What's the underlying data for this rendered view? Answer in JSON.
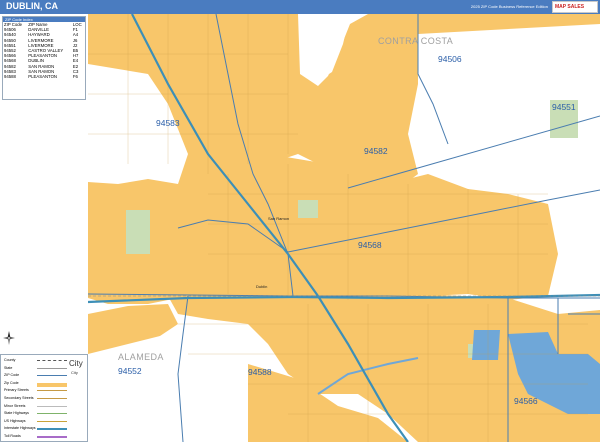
{
  "header": {
    "title": "DUBLIN, CA",
    "subtitle": "2025 ZIP Code Business Reference Edition",
    "logo_text": "MAP SALES"
  },
  "zip_table": {
    "panel_title": "ZIP Code Index",
    "columns": [
      "ZIP Code",
      "ZIP Name",
      "LOC"
    ],
    "rows": [
      [
        "94506",
        "DANVILLE",
        "F1"
      ],
      [
        "94540",
        "HAYWARD",
        "A4"
      ],
      [
        "94550",
        "LIVERMORE",
        "J6"
      ],
      [
        "94551",
        "LIVERMORE",
        "J2"
      ],
      [
        "94552",
        "CASTRO VALLEY",
        "B5"
      ],
      [
        "94566",
        "PLEASANTON",
        "H7"
      ],
      [
        "94568",
        "DUBLIN",
        "E4"
      ],
      [
        "94582",
        "SAN RAMON",
        "E2"
      ],
      [
        "94583",
        "SAN RAMON",
        "C3"
      ],
      [
        "94588",
        "PLEASANTON",
        "F6"
      ]
    ]
  },
  "legend": {
    "items": [
      "County",
      "State",
      "ZIP Code",
      "Zip Code",
      "Primary Streets",
      "Secondary Streets",
      "Minor Streets",
      "State Highways",
      "US Highways",
      "Interstate Highways",
      "Toll Roads"
    ],
    "city_big": "City",
    "city_small": "City"
  },
  "map": {
    "zip_labels": [
      "94506",
      "94551",
      "94583",
      "94582",
      "94568",
      "94552",
      "94588",
      "94566"
    ],
    "area_labels": [
      "CONTRA COSTA",
      "ALAMEDA"
    ],
    "city_labels": [
      "Dublin",
      "San Ramon"
    ],
    "colors": {
      "urban": "#f8c66a",
      "rural": "#ffffff",
      "park": "#c9deb6",
      "water": "#6fa7d8",
      "boundary": "#4a7db0",
      "highway": "#3d8fb7"
    }
  }
}
